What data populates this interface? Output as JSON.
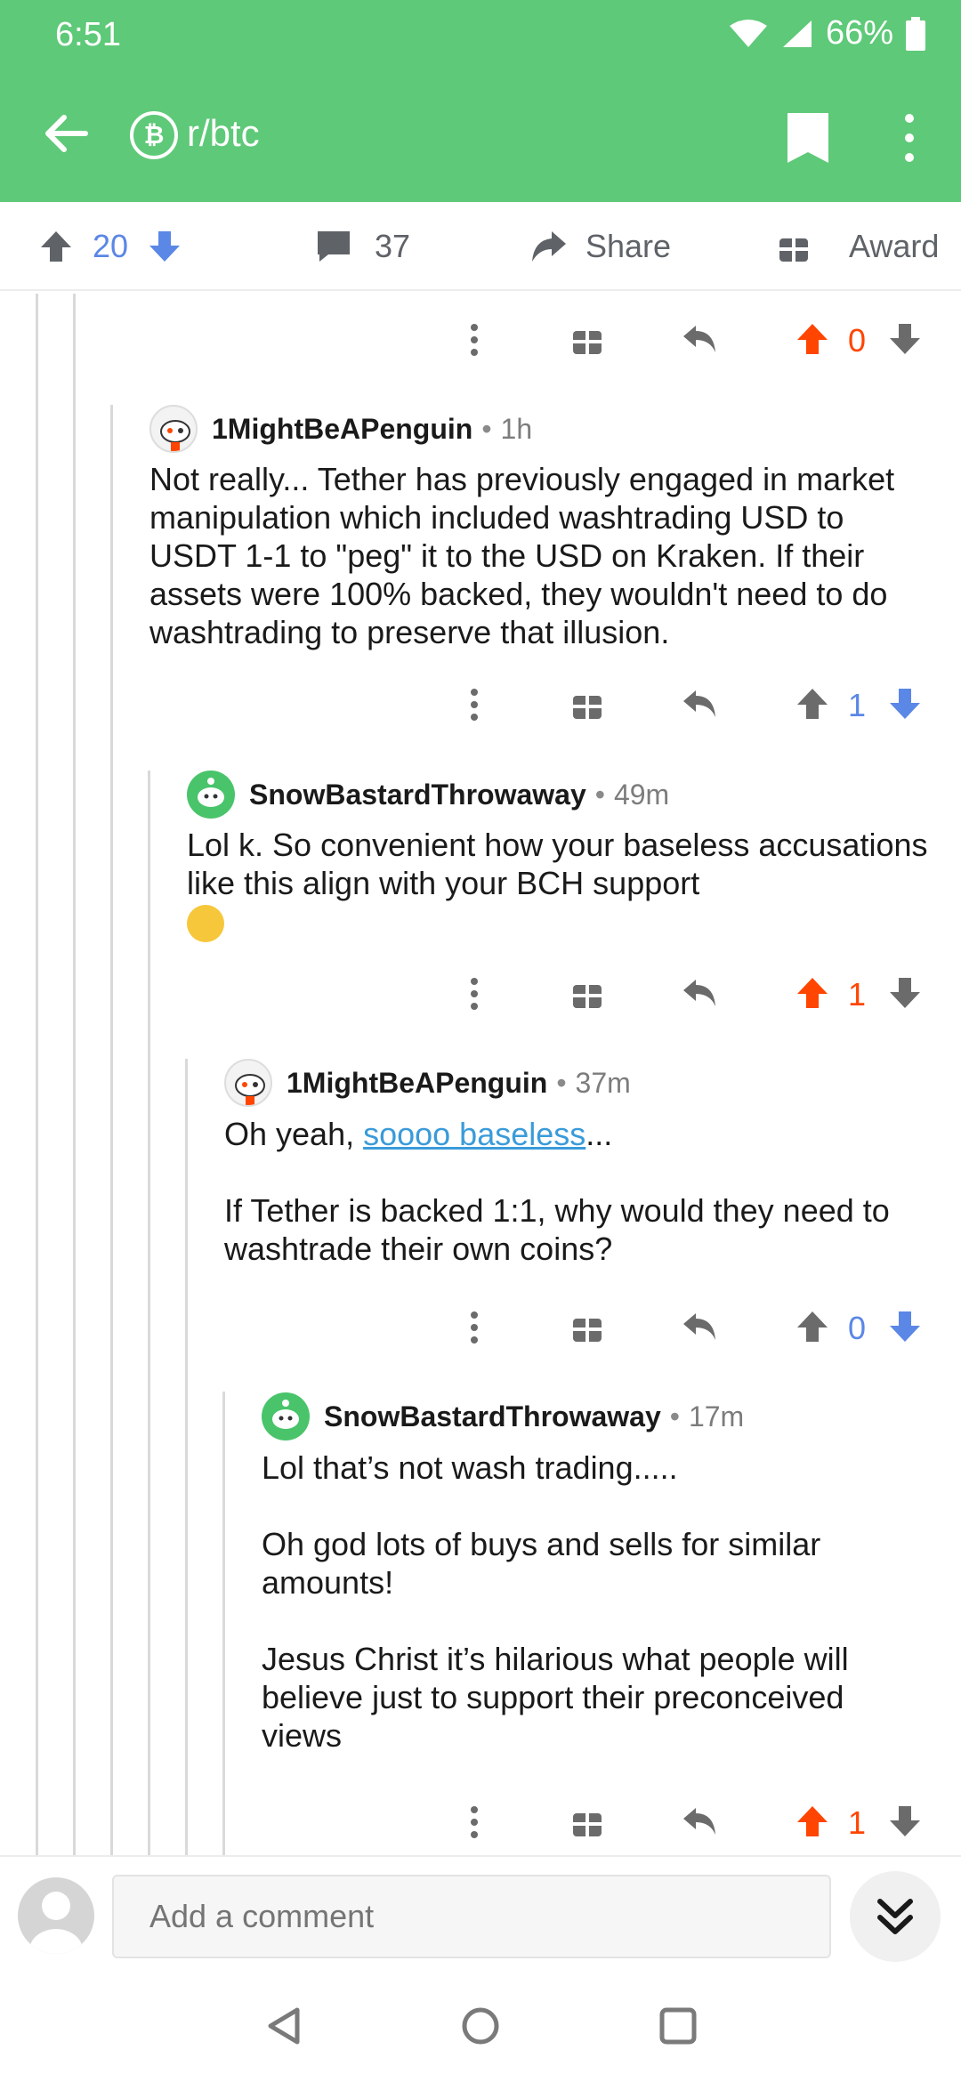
{
  "status": {
    "time": "6:51",
    "battery": "66%"
  },
  "header": {
    "subreddit": "r/btc"
  },
  "post_actions": {
    "score": "20",
    "comments": "37",
    "share": "Share",
    "award": "Award"
  },
  "first_row": {
    "score": "0"
  },
  "comments": [
    {
      "author": "1MightBeAPenguin",
      "age": "1h",
      "body": [
        "Not really... Tether has previously engaged in market manipulation which included washtrading USD to USDT 1-1 to \"peg\" it to the USD on Kraken. If their assets were 100% backed, they wouldn't need to do washtrading to preserve that illusion."
      ],
      "score": "1",
      "vote": "down"
    },
    {
      "author": "SnowBastardThrowaway",
      "age": "49m",
      "body": [
        "Lol k. So convenient how your baseless accusations like this align with your BCH support"
      ],
      "emoji": "thinking-face",
      "score": "1",
      "vote": "up"
    },
    {
      "author": "1MightBeAPenguin",
      "age": "37m",
      "body_prefix": "Oh yeah, ",
      "body_link": "soooo baseless",
      "body_suffix": "...",
      "body2": "If Tether is backed 1:1, why would they need to washtrade their own coins?",
      "score": "0",
      "vote": "down"
    },
    {
      "author": "SnowBastardThrowaway",
      "age": "17m",
      "body": [
        "Lol that’s not wash trading.....",
        "Oh god lots of buys and sells for similar amounts!",
        "Jesus Christ it’s hilarious what people will believe just to support their preconceived views"
      ],
      "score": "1",
      "vote": "up"
    }
  ],
  "composer": {
    "placeholder": "Add a comment"
  },
  "colors": {
    "brand": "#5ec978",
    "upvote": "#ff4500",
    "downvote": "#5b87e6",
    "neutral": "#5f6368"
  }
}
